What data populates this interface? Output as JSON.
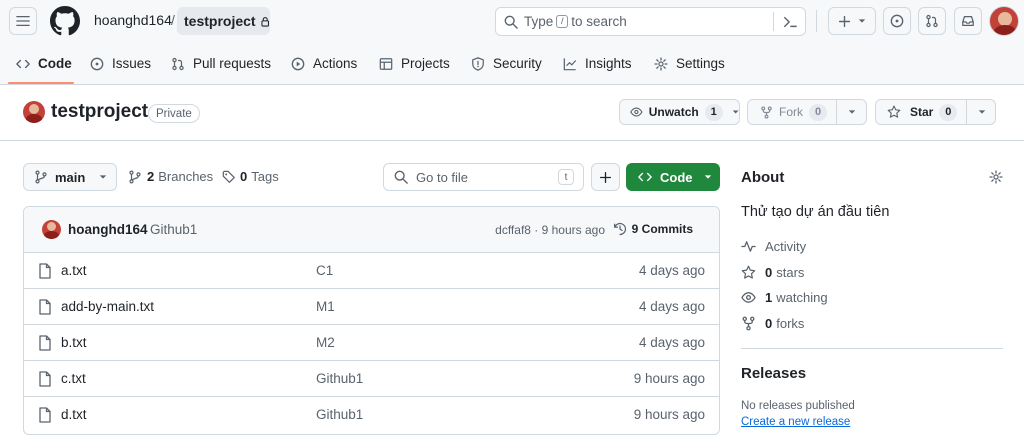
{
  "header": {
    "owner": "hoanghd164",
    "separator": "/",
    "repo": "testproject",
    "search_prefix": "Type",
    "search_key": "/",
    "search_suffix": "to search"
  },
  "tabs": [
    {
      "label": "Code",
      "icon": "code-icon",
      "active": true
    },
    {
      "label": "Issues",
      "icon": "issue-icon"
    },
    {
      "label": "Pull requests",
      "icon": "pull-request-icon"
    },
    {
      "label": "Actions",
      "icon": "play-icon"
    },
    {
      "label": "Projects",
      "icon": "table-icon"
    },
    {
      "label": "Security",
      "icon": "shield-icon"
    },
    {
      "label": "Insights",
      "icon": "graph-icon"
    },
    {
      "label": "Settings",
      "icon": "gear-icon"
    }
  ],
  "repo": {
    "name": "testproject",
    "visibility": "Private",
    "unwatch_label": "Unwatch",
    "watch_count": "1",
    "fork_label": "Fork",
    "fork_count": "0",
    "star_label": "Star",
    "star_count": "0"
  },
  "toolbar": {
    "branch": "main",
    "branches_count": "2",
    "branches_label": "Branches",
    "tags_count": "0",
    "tags_label": "Tags",
    "goto_placeholder": "Go to file",
    "goto_key": "t",
    "code_label": "Code"
  },
  "commit": {
    "author": "hoanghd164",
    "message": "Github1",
    "hash_time": "dcffaf8 · 9 hours ago",
    "commits_label": "9 Commits"
  },
  "files": [
    {
      "name": "a.txt",
      "message": "C1",
      "age": "4 days ago"
    },
    {
      "name": "add-by-main.txt",
      "message": "M1",
      "age": "4 days ago"
    },
    {
      "name": "b.txt",
      "message": "M2",
      "age": "4 days ago"
    },
    {
      "name": "c.txt",
      "message": "Github1",
      "age": "9 hours ago"
    },
    {
      "name": "d.txt",
      "message": "Github1",
      "age": "9 hours ago"
    }
  ],
  "about": {
    "title": "About",
    "description": "Thử tạo dự án đầu tiên",
    "activity_label": "Activity",
    "stars_count": "0",
    "stars_label": "stars",
    "watching_count": "1",
    "watching_label": "watching",
    "forks_count": "0",
    "forks_label": "forks"
  },
  "releases": {
    "title": "Releases",
    "none_text": "No releases published",
    "create_link": "Create a new release"
  },
  "colors": {
    "accent_green": "#1f883d",
    "link_blue": "#0969da",
    "tab_underline": "#fd8c73",
    "avatar_red": "#c2423a"
  }
}
